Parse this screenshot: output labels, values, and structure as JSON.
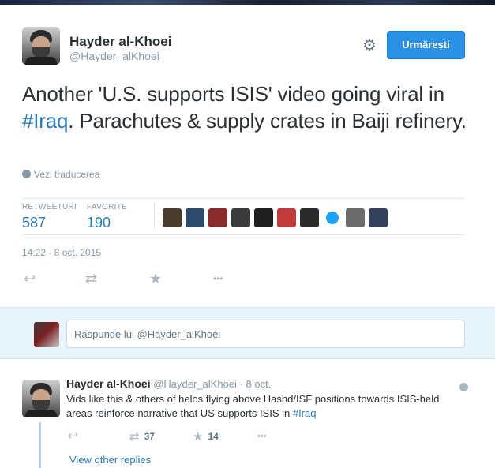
{
  "tweet": {
    "author_name": "Hayder al-Khoei",
    "author_handle": "@Hayder_alKhoei",
    "follow_label": "Urmărești",
    "text_before": "Another 'U.S. supports ISIS' video going viral in ",
    "hashtag": "#Iraq",
    "text_after": ". Parachutes & supply crates in Baiji refinery.",
    "translate_label": "Vezi traducerea",
    "stats": {
      "retweets_label": "RETWEETURI",
      "retweets_value": "587",
      "favorites_label": "FAVORITE",
      "favorites_value": "190"
    },
    "timestamp": "14:22 - 8 oct. 2015",
    "favoriter_avatar_colors": [
      "#4a3b2c",
      "#2d4a6b",
      "#8a2b2b",
      "#3b3b3b",
      "#1e1e1e",
      "#c23b3b",
      "#2a2a2a",
      "#1da1f2",
      "#6b6b6b",
      "#33415a"
    ]
  },
  "reply_box": {
    "placeholder": "Răspunde lui @Hayder_alKhoei"
  },
  "reply": {
    "author_name": "Hayder al-Khoei",
    "author_handle": "@Hayder_alKhoei",
    "separator": "·",
    "time": "8 oct.",
    "text_before": "Vids like this & others of helos flying above Hashd/ISF positions towards ISIS-held areas reinforce narrative that US supports ISIS in ",
    "hashtag": "#Iraq",
    "retweet_count": "37",
    "favorite_count": "14",
    "view_replies": "View other replies"
  },
  "icons": {
    "gear": "⚙",
    "reply": "↩",
    "retweet": "⇄",
    "favorite": "★",
    "more": "•••"
  },
  "colors": {
    "accent": "#2b7bb9",
    "follow_button": "#2b91e5",
    "reply_area_bg": "#e8f4fb"
  }
}
